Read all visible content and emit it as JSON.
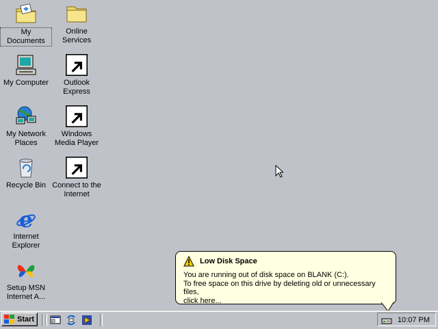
{
  "desktop": {
    "icons": [
      {
        "label": "My Documents"
      },
      {
        "label": "Online Services"
      },
      {
        "label": "My Computer"
      },
      {
        "label": "Outlook Express"
      },
      {
        "label": "My Network Places"
      },
      {
        "label": "Windows Media Player"
      },
      {
        "label": "Recycle Bin"
      },
      {
        "label": "Connect to the Internet"
      },
      {
        "label": "Internet Explorer"
      },
      {
        "label": "Setup MSN Internet A..."
      }
    ]
  },
  "balloon": {
    "title": "Low Disk Space",
    "line1": "You are running out of disk space on BLANK (C:).",
    "line2": "To free space on this drive by deleting old or unnecessary files,",
    "line3": "click here..."
  },
  "taskbar": {
    "start_label": "Start",
    "clock": "10:07 PM"
  },
  "colors": {
    "desktop": "#bfc3c9",
    "balloon": "#ffffe1"
  }
}
